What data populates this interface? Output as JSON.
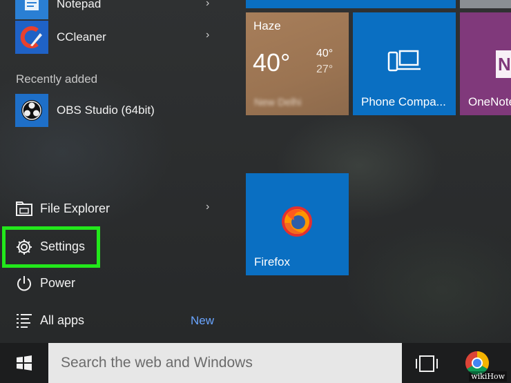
{
  "left_panel": {
    "apps_top": [
      {
        "label": "Notepad",
        "has_submenu": true,
        "icon": "notepad-icon"
      },
      {
        "label": "CCleaner",
        "has_submenu": true,
        "icon": "ccleaner-icon"
      }
    ],
    "recently_added_label": "Recently added",
    "recent_apps": [
      {
        "label": "OBS Studio (64bit)",
        "icon": "obs-icon"
      }
    ],
    "system_items": [
      {
        "label": "File Explorer",
        "icon": "file-explorer-icon",
        "has_submenu": true
      },
      {
        "label": "Settings",
        "icon": "gear-icon",
        "highlighted": true
      },
      {
        "label": "Power",
        "icon": "power-icon"
      },
      {
        "label": "All apps",
        "icon": "list-icon",
        "badge": "New"
      }
    ]
  },
  "tiles": {
    "weather": {
      "city": "Haze",
      "temp": "40°",
      "high": "40°",
      "low": "27°",
      "location": "New Delhi"
    },
    "phone_companion": {
      "label": "Phone Compa..."
    },
    "onenote": {
      "label": "OneNote"
    },
    "firefox": {
      "label": "Firefox"
    }
  },
  "taskbar": {
    "search_placeholder": "Search the web and Windows"
  },
  "watermark": "wikiHow",
  "colors": {
    "tile_blue": "#0a6fc2",
    "onenote_purple": "#80397b",
    "weather_tan": "#a07855",
    "highlight_green": "#22e81b",
    "badge_blue": "#6aa5ff"
  }
}
